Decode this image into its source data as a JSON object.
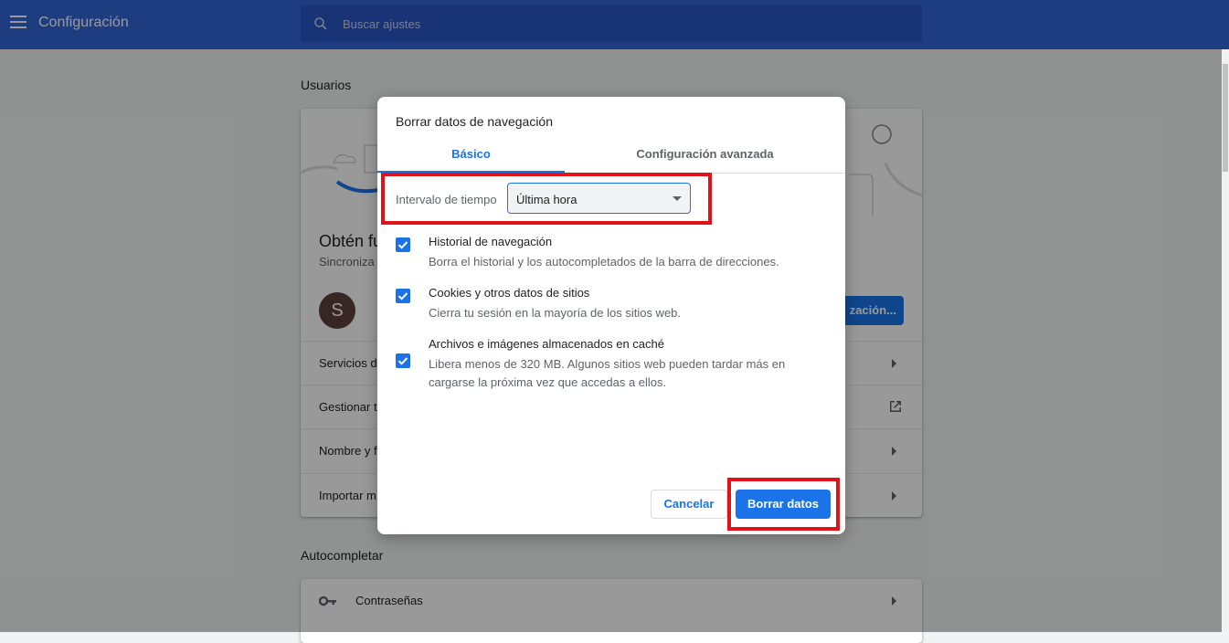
{
  "header": {
    "title": "Configuración",
    "search_placeholder": "Buscar ajustes"
  },
  "background": {
    "section_users": "Usuarios",
    "card_heading": "Obtén fu",
    "card_subtitle": "Sincroniza",
    "avatar_letter": "S",
    "sync_button": "zación...",
    "rows": [
      "Servicios d",
      "Gestionar t",
      "Nombre y f",
      "Importar m"
    ],
    "section_autofill": "Autocompletar",
    "autofill_rows": [
      "Contraseñas"
    ]
  },
  "dialog": {
    "title": "Borrar datos de navegación",
    "tabs": [
      "Básico",
      "Configuración avanzada"
    ],
    "interval_label": "Intervalo de tiempo",
    "interval_value": "Última hora",
    "items": [
      {
        "title": "Historial de navegación",
        "desc": "Borra el historial y los autocompletados de la barra de direcciones.",
        "checked": true
      },
      {
        "title": "Cookies y otros datos de sitios",
        "desc": "Cierra tu sesión en la mayoría de los sitios web.",
        "checked": true
      },
      {
        "title": "Archivos e imágenes almacenados en caché",
        "desc": "Libera menos de 320 MB. Algunos sitios web pueden tardar más en cargarse la próxima vez que accedas a ellos.",
        "checked": true
      }
    ],
    "cancel_label": "Cancelar",
    "confirm_label": "Borrar datos"
  },
  "colors": {
    "header": "#3367d6",
    "accent": "#1a73e8",
    "highlight": "#e0131b"
  }
}
